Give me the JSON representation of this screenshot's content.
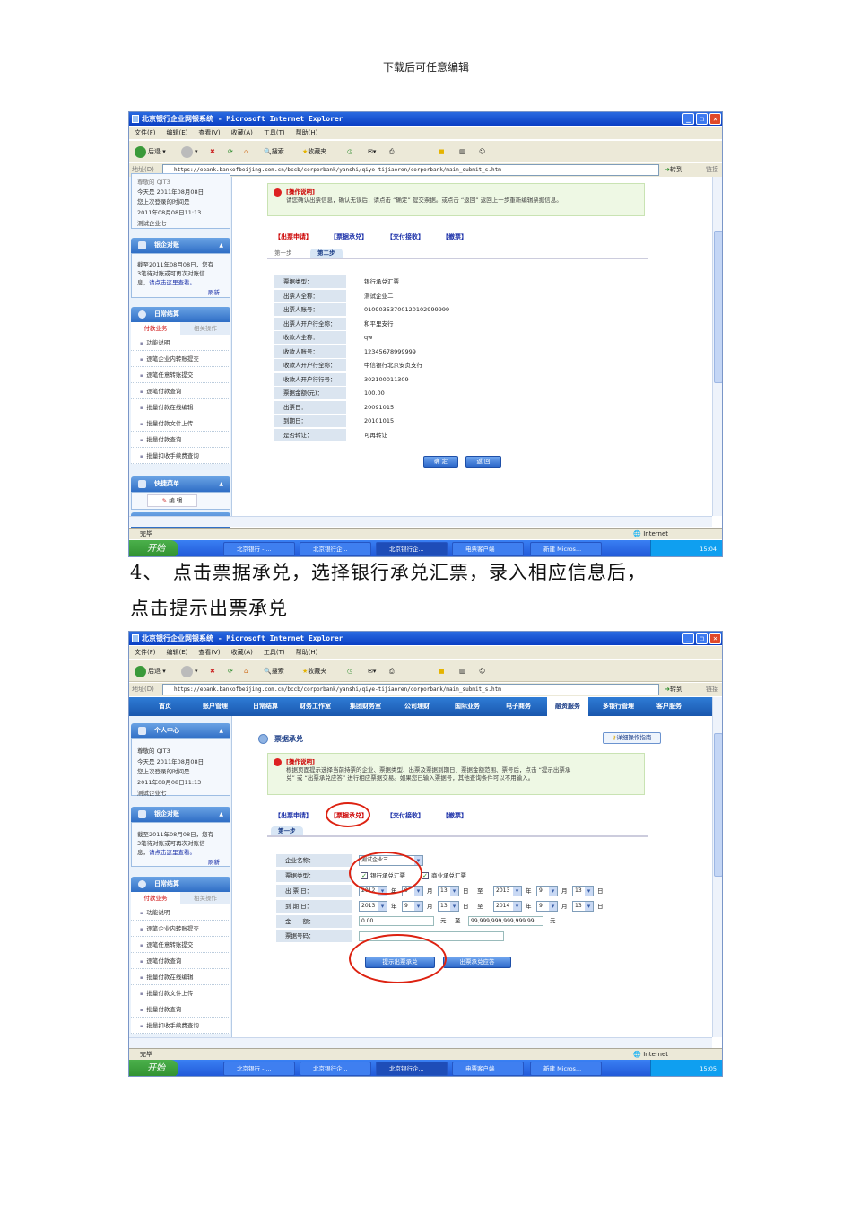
{
  "page_header": "下载后可任意编辑",
  "instruction": {
    "line1": "4、　点击票据承兑，选择银行承兑汇票，录入相应信息后，",
    "line2": "点击提示出票承兑"
  },
  "browser": {
    "title": "北京银行企业网银系统 - Microsoft Internet Explorer",
    "menu": [
      "文件(F)",
      "编辑(E)",
      "查看(V)",
      "收藏(A)",
      "工具(T)",
      "帮助(H)"
    ],
    "toolbar": {
      "back": "后退",
      "search": "搜索",
      "favorites": "收藏夹"
    },
    "address_label": "地址(D)",
    "url": "https://ebank.bankofbeijing.com.cn/bccb/corporbank/yanshi/qiye-tijiaoren/corporbank/main_submit_s.htm",
    "go": "转到",
    "links": "链接",
    "status_text": "完毕",
    "zone": "Internet"
  },
  "taskbar": {
    "start": "开始",
    "tasks": [
      "北京银行 - ...",
      "北京银行企...",
      "北京银行企...",
      "电票客户端",
      "新建 Micros..."
    ],
    "time1": "15:04",
    "time2": "15:05"
  },
  "sidebar": {
    "personal_title": "个人中心",
    "greeting": "尊敬的 QIT3",
    "today": "今天是 2011年08月08日",
    "last_login_label": "您上次登录的时间是",
    "last_login": "2011年08月08日11:13",
    "company": "测试企业七",
    "recon_title": "银企对账",
    "recon_text": [
      "截至2011年08月08日，您有",
      "3笔待对账或可再次对账信",
      "息，"
    ],
    "recon_link": "请点击这里查看。",
    "refresh": "刷新",
    "daily_title": "日常结算",
    "tab_payment": "付款业务",
    "tab_related": "相关操作",
    "items": [
      "功能说明",
      "逐笔企业内转账提交",
      "逐笔任意转账提交",
      "逐笔付款查询",
      "批量付款在线编辑",
      "批量付款文件上传",
      "批量付款查询",
      "批量扣收手续费查询"
    ],
    "quick_title": "快捷菜单",
    "edit": "编 辑"
  },
  "bill_links": [
    "【出票申请】",
    "【票据承兑】",
    "【交付接收】",
    "【撤票】"
  ],
  "notice_title": "[操作说明]",
  "screen1": {
    "notice": "请您确认出票信息，确认无误后，请点击 “确定” 提交票据。或点击 “返回” 返回上一步重新编辑票据信息。",
    "step1": "第一步",
    "step2": "第二步",
    "rows": [
      {
        "label": "票据类型：",
        "value": "银行承兑汇票"
      },
      {
        "label": "出票人全称：",
        "value": "测试企业二"
      },
      {
        "label": "出票人账号：",
        "value": "01090353700120102999999"
      },
      {
        "label": "出票人开户行全称：",
        "value": "和平里支行"
      },
      {
        "label": "收款人全称：",
        "value": "qw"
      },
      {
        "label": "收款人账号：",
        "value": "12345678999999"
      },
      {
        "label": "收款人开户行全称：",
        "value": "中信银行北京安贞支行"
      },
      {
        "label": "收款人开户行行号：",
        "value": "302100011309"
      },
      {
        "label": "票据金额(元)：",
        "value": "100.00"
      },
      {
        "label": "出票日：",
        "value": "20091015"
      },
      {
        "label": "到期日：",
        "value": "20101015"
      },
      {
        "label": "是否转让：",
        "value": "可再转让"
      }
    ],
    "confirm": "确 定",
    "back": "返 回"
  },
  "screen2": {
    "nav": [
      "首页",
      "账户管理",
      "日常结算",
      "财务工作室",
      "集团财务室",
      "公司理财",
      "国际业务",
      "电子商务",
      "融资服务",
      "多银行管理",
      "客户服务"
    ],
    "heading": "票据承兑",
    "guide": "详细操作指南",
    "notice_l1": "根据页面提示选择当前持票的企业、票据类型、出票及票据到期日、票据金额范围、票号后，点击 “提示出票承",
    "notice_l2": "兑” 或 “出票承兑应答” 进行相应票据交易。如果您已输入票据号，其他查询条件可以不用输入。",
    "step1": "第一步",
    "form": {
      "company_label": "企业名称：",
      "company": "测试企业三",
      "type_label": "票据类型：",
      "type_bank": "银行承兑汇票",
      "type_commercial": "商业承兑汇票",
      "issue_label": "出 票 日：",
      "issue_from": [
        "2012",
        "9",
        "13"
      ],
      "issue_to": [
        "2013",
        "9",
        "13"
      ],
      "due_label": "到 期 日：",
      "due_from": [
        "2013",
        "9",
        "13"
      ],
      "due_to": [
        "2014",
        "9",
        "13"
      ],
      "amount_label": "金　　额：",
      "amount_from": "0.00",
      "amount_to": "99,999,999,999,999.99",
      "number_label": "票据号码：",
      "number": "",
      "year": "年",
      "month": "月",
      "day": "日",
      "to": "至",
      "yuan": "元"
    },
    "btn_present": "提示出票承兑",
    "btn_reply": "出票承兑应答"
  }
}
